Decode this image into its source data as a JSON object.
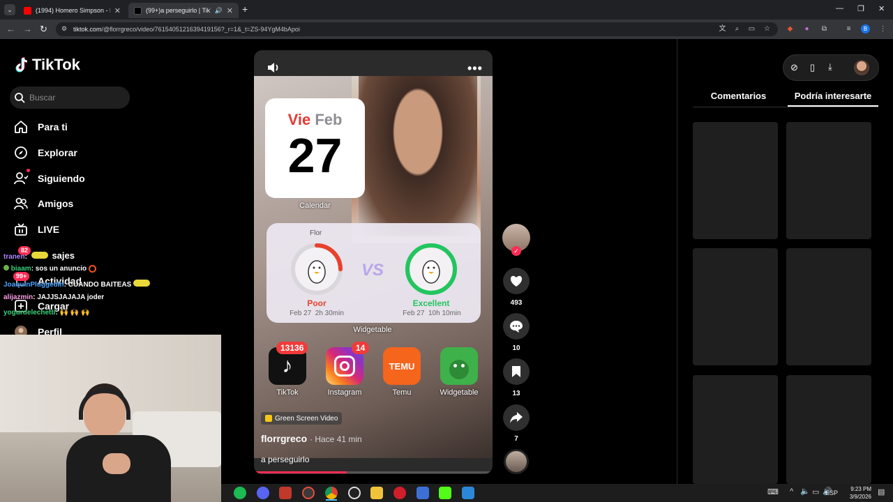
{
  "browser": {
    "tabs": [
      {
        "title": "(1994) Homero Simpson - N de",
        "icon": "youtube-icon",
        "color": "#ff0000"
      },
      {
        "title": "(99+)a perseguirlo | TikTok",
        "icon": "tiktok-icon",
        "color": "#000000"
      }
    ],
    "url_host": "tiktok.com",
    "url_path": "/@florrgreco/video/7615405121639419156?_r=1&_t=ZS-94YgM4bApoi"
  },
  "sidebar": {
    "logo_text": "TikTok",
    "search_placeholder": "Buscar",
    "items": [
      {
        "label": "Para ti",
        "icon": "home-icon"
      },
      {
        "label": "Explorar",
        "icon": "compass-icon"
      },
      {
        "label": "Siguiendo",
        "icon": "following-icon"
      },
      {
        "label": "Amigos",
        "icon": "friends-icon"
      },
      {
        "label": "LIVE",
        "icon": "live-icon"
      },
      {
        "label": "Actividad",
        "icon": "activity-icon"
      },
      {
        "label": "Cargar",
        "icon": "upload-icon"
      },
      {
        "label": "Perfil",
        "icon": "profile-icon"
      }
    ],
    "badges": {
      "messages": "82",
      "activity": "99+"
    }
  },
  "chat": [
    {
      "user": "tranen",
      "message": "sajes"
    },
    {
      "user": "biaam",
      "message": "sos un anuncio"
    },
    {
      "user": "JoaquinPluggedIn",
      "message": "CUANDO BAITEAS"
    },
    {
      "user": "alijazmin",
      "message": "JAJJSJAJAJA joder"
    },
    {
      "user": "yogurdelechetti",
      "message": ""
    }
  ],
  "video": {
    "calendar": {
      "day": "Vie",
      "month": "Feb",
      "date": "27",
      "label": "Calendar"
    },
    "widget": {
      "name": "Flor",
      "left_status": "Poor",
      "left_date": "Feb 27",
      "left_time": "2h 30min",
      "left_level": 0.25,
      "vs": "VS",
      "right_status": "Excellent",
      "right_date": "Feb 27",
      "right_time": "10h 10min",
      "right_level": 1.0,
      "label": "Widgetable"
    },
    "apps": [
      {
        "name": "TikTok",
        "badge": "13136",
        "color": "#111111"
      },
      {
        "name": "Instagram",
        "badge": "14",
        "color": "#d62976"
      },
      {
        "name": "Temu",
        "badge": "",
        "color": "#f5651c"
      },
      {
        "name": "Widgetable",
        "badge": "",
        "color": "#3fb14a"
      }
    ],
    "tag": "Green Screen Video",
    "author": "florrgreco",
    "time_ago": "· Hace 41 min",
    "caption": "a perseguirlo",
    "progress": 0.39
  },
  "actions": {
    "likes": "493",
    "comments": "10",
    "saves": "13",
    "shares": "7"
  },
  "right_panel": {
    "tabs": [
      "Comentarios",
      "Podría interesarte"
    ],
    "active_tab": 1
  },
  "taskbar": {
    "lang": "ESP",
    "time": "9:23 PM",
    "date": "3/9/2026"
  }
}
